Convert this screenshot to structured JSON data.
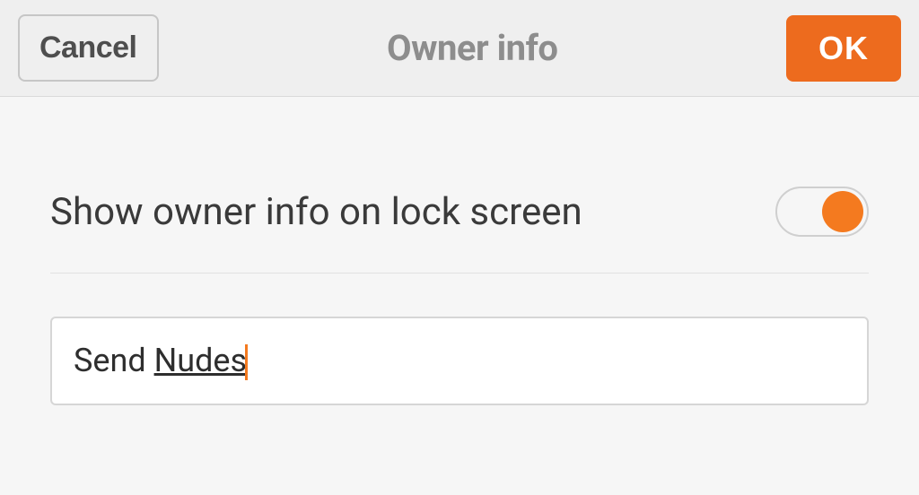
{
  "header": {
    "cancel_label": "Cancel",
    "title": "Owner info",
    "ok_label": "OK"
  },
  "toggle": {
    "label": "Show owner info on lock screen",
    "state": true
  },
  "input": {
    "value_plain": "Send ",
    "value_underlined": "Nudes"
  },
  "colors": {
    "accent": "#f47a1f",
    "ok_bg": "#ed6b1e"
  }
}
